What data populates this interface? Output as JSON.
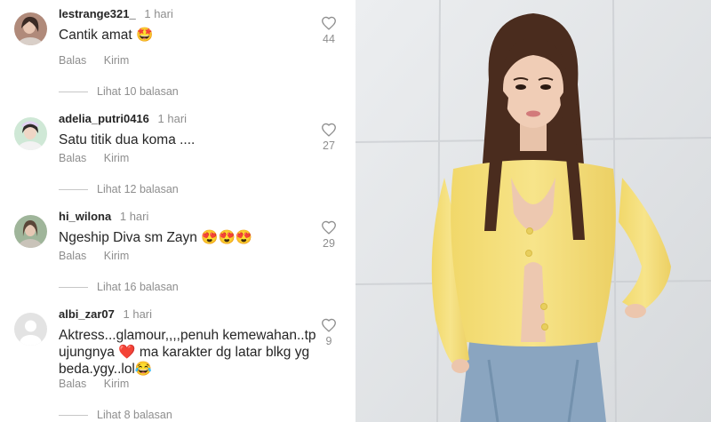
{
  "comments": [
    {
      "username": "lestrange321_",
      "time": "1 hari",
      "text": "Cantik amat 🤩",
      "likes": "44",
      "reply": "Balas",
      "send": "Kirim",
      "replies": "Lihat 10 balasan"
    },
    {
      "username": "adelia_putri0416",
      "time": "1 hari",
      "text": "Satu titik dua koma ....",
      "likes": "27",
      "reply": "Balas",
      "send": "Kirim",
      "replies": "Lihat 12 balasan"
    },
    {
      "username": "hi_wilona",
      "time": "1 hari",
      "text": "Ngeship Diva sm Zayn 😍😍😍",
      "likes": "29",
      "reply": "Balas",
      "send": "Kirim",
      "replies": "Lihat 16 balasan"
    },
    {
      "username": "albi_zar07",
      "time": "1 hari",
      "text": "Aktress...glamour,,,,penuh kemewahan..tp ujungnya ❤️ ma karakter dg latar blkg yg beda.ygy..lol😂",
      "likes": "9",
      "reply": "Balas",
      "send": "Kirim",
      "replies": "Lihat 8 balasan"
    }
  ],
  "colors": {
    "text": "#262626",
    "muted": "#8e8e8e",
    "heart_outline": "#8e8e8e",
    "divider": "#c7c7c7",
    "cardigan": "#f3dc72"
  },
  "icons": {
    "like": "heart-outline-icon",
    "default_avatar": "person-silhouette-icon"
  }
}
